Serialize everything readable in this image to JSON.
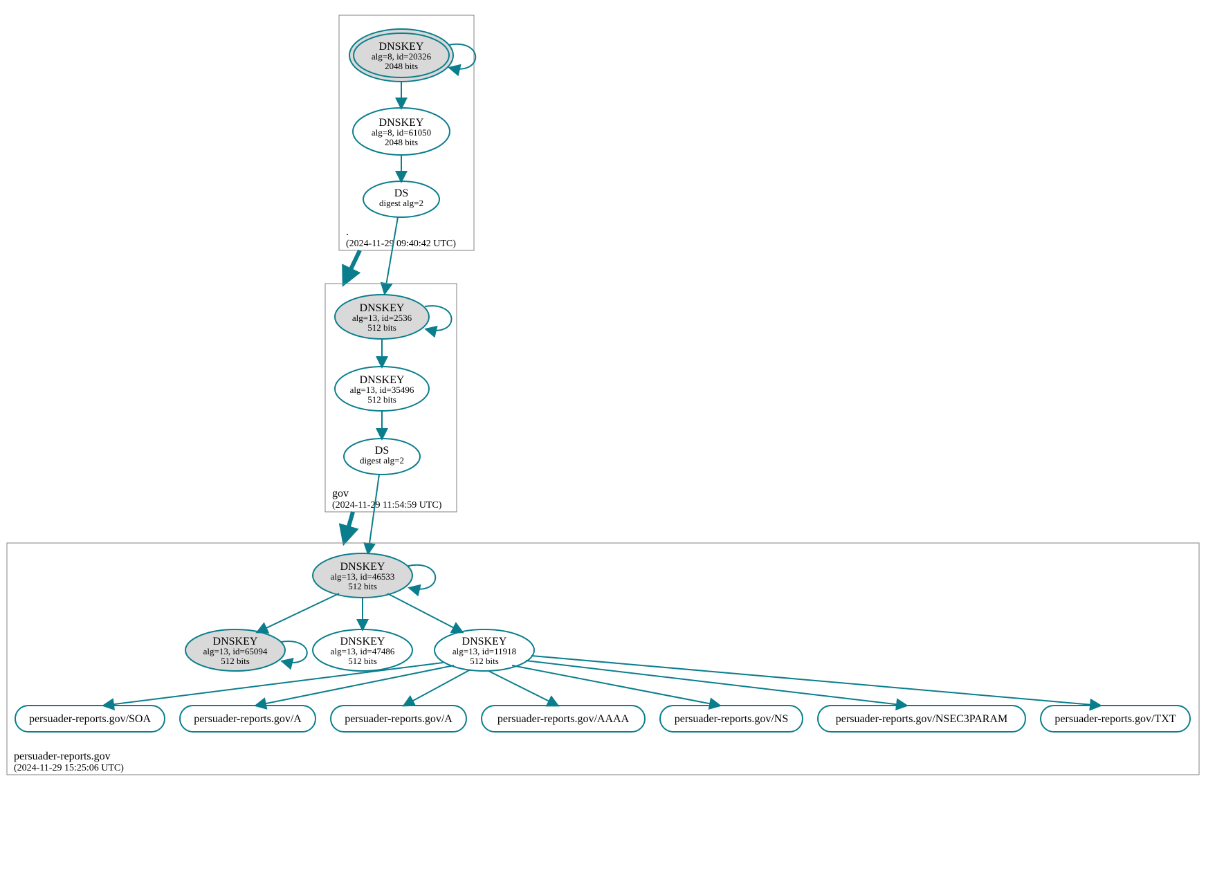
{
  "colors": {
    "edge": "#0a7e8c",
    "fillGray": "#d9d9d9",
    "boxStroke": "#808080"
  },
  "zones": {
    "root": {
      "label": ".",
      "timestamp": "(2024-11-29 09:40:42 UTC)"
    },
    "gov": {
      "label": "gov",
      "timestamp": "(2024-11-29 11:54:59 UTC)"
    },
    "domain": {
      "label": "persuader-reports.gov",
      "timestamp": "(2024-11-29 15:25:06 UTC)"
    }
  },
  "nodes": {
    "rootKSK": {
      "t": "DNSKEY",
      "s1": "alg=8, id=20326",
      "s2": "2048 bits"
    },
    "rootZSK": {
      "t": "DNSKEY",
      "s1": "alg=8, id=61050",
      "s2": "2048 bits"
    },
    "rootDS": {
      "t": "DS",
      "s1": "digest alg=2",
      "s2": ""
    },
    "govKSK": {
      "t": "DNSKEY",
      "s1": "alg=13, id=2536",
      "s2": "512 bits"
    },
    "govZSK": {
      "t": "DNSKEY",
      "s1": "alg=13, id=35496",
      "s2": "512 bits"
    },
    "govDS": {
      "t": "DS",
      "s1": "digest alg=2",
      "s2": ""
    },
    "domKSK": {
      "t": "DNSKEY",
      "s1": "alg=13, id=46533",
      "s2": "512 bits"
    },
    "domZSK1": {
      "t": "DNSKEY",
      "s1": "alg=13, id=65094",
      "s2": "512 bits"
    },
    "domZSK2": {
      "t": "DNSKEY",
      "s1": "alg=13, id=47486",
      "s2": "512 bits"
    },
    "domZSK3": {
      "t": "DNSKEY",
      "s1": "alg=13, id=11918",
      "s2": "512 bits"
    }
  },
  "rr": {
    "soa": "persuader-reports.gov/SOA",
    "a1": "persuader-reports.gov/A",
    "a2": "persuader-reports.gov/A",
    "aaaa": "persuader-reports.gov/AAAA",
    "ns": "persuader-reports.gov/NS",
    "nsec": "persuader-reports.gov/NSEC3PARAM",
    "txt": "persuader-reports.gov/TXT"
  },
  "chart_data": {
    "type": "graph",
    "description": "DNSSEC authentication chain / DNSViz-style graph",
    "zones": [
      {
        "name": ".",
        "timestamp": "2024-11-29 09:40:42 UTC",
        "records": [
          {
            "id": "rootKSK",
            "type": "DNSKEY",
            "alg": 8,
            "keyid": 20326,
            "bits": 2048,
            "ksk": true,
            "trust_anchor": true
          },
          {
            "id": "rootZSK",
            "type": "DNSKEY",
            "alg": 8,
            "keyid": 61050,
            "bits": 2048,
            "ksk": false
          },
          {
            "id": "rootDS",
            "type": "DS",
            "digest_alg": 2
          }
        ]
      },
      {
        "name": "gov",
        "timestamp": "2024-11-29 11:54:59 UTC",
        "records": [
          {
            "id": "govKSK",
            "type": "DNSKEY",
            "alg": 13,
            "keyid": 2536,
            "bits": 512,
            "ksk": true
          },
          {
            "id": "govZSK",
            "type": "DNSKEY",
            "alg": 13,
            "keyid": 35496,
            "bits": 512,
            "ksk": false
          },
          {
            "id": "govDS",
            "type": "DS",
            "digest_alg": 2
          }
        ]
      },
      {
        "name": "persuader-reports.gov",
        "timestamp": "2024-11-29 15:25:06 UTC",
        "records": [
          {
            "id": "domKSK",
            "type": "DNSKEY",
            "alg": 13,
            "keyid": 46533,
            "bits": 512,
            "ksk": true
          },
          {
            "id": "domZSK1",
            "type": "DNSKEY",
            "alg": 13,
            "keyid": 65094,
            "bits": 512,
            "ksk": false
          },
          {
            "id": "domZSK2",
            "type": "DNSKEY",
            "alg": 13,
            "keyid": 47486,
            "bits": 512,
            "ksk": false
          },
          {
            "id": "domZSK3",
            "type": "DNSKEY",
            "alg": 13,
            "keyid": 11918,
            "bits": 512,
            "ksk": false
          },
          {
            "id": "soa",
            "type": "RRset",
            "name": "persuader-reports.gov/SOA"
          },
          {
            "id": "a1",
            "type": "RRset",
            "name": "persuader-reports.gov/A"
          },
          {
            "id": "a2",
            "type": "RRset",
            "name": "persuader-reports.gov/A"
          },
          {
            "id": "aaaa",
            "type": "RRset",
            "name": "persuader-reports.gov/AAAA"
          },
          {
            "id": "ns",
            "type": "RRset",
            "name": "persuader-reports.gov/NS"
          },
          {
            "id": "nsec",
            "type": "RRset",
            "name": "persuader-reports.gov/NSEC3PARAM"
          },
          {
            "id": "txt",
            "type": "RRset",
            "name": "persuader-reports.gov/TXT"
          }
        ]
      }
    ],
    "edges": [
      {
        "from": "rootKSK",
        "to": "rootKSK",
        "kind": "self-sig"
      },
      {
        "from": "rootKSK",
        "to": "rootZSK"
      },
      {
        "from": "rootZSK",
        "to": "rootDS"
      },
      {
        "from": "rootDS",
        "to": "govKSK",
        "kind": "delegation"
      },
      {
        "from": "govKSK",
        "to": "govKSK",
        "kind": "self-sig"
      },
      {
        "from": "govKSK",
        "to": "govZSK"
      },
      {
        "from": "govZSK",
        "to": "govDS"
      },
      {
        "from": "govDS",
        "to": "domKSK",
        "kind": "delegation"
      },
      {
        "from": "domKSK",
        "to": "domKSK",
        "kind": "self-sig"
      },
      {
        "from": "domKSK",
        "to": "domZSK1"
      },
      {
        "from": "domKSK",
        "to": "domZSK2"
      },
      {
        "from": "domKSK",
        "to": "domZSK3"
      },
      {
        "from": "domZSK1",
        "to": "domZSK1",
        "kind": "self-sig"
      },
      {
        "from": "domZSK3",
        "to": "soa"
      },
      {
        "from": "domZSK3",
        "to": "a1"
      },
      {
        "from": "domZSK3",
        "to": "a2"
      },
      {
        "from": "domZSK3",
        "to": "aaaa"
      },
      {
        "from": "domZSK3",
        "to": "ns"
      },
      {
        "from": "domZSK3",
        "to": "nsec"
      },
      {
        "from": "domZSK3",
        "to": "txt"
      }
    ]
  }
}
